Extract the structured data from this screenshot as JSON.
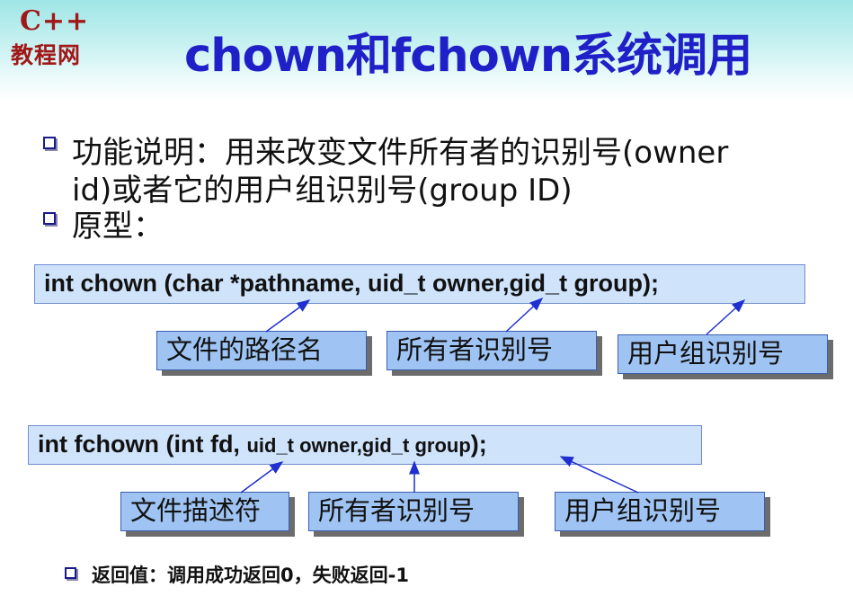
{
  "logo": {
    "line1": "C++",
    "line2": "教程网"
  },
  "title": "chown和fchown系统调用",
  "bullets": {
    "b1_line1": "功能说明：用来改变文件所有者的识别号(owner",
    "b1_line2": "id)或者它的用户组识别号(group ID)",
    "b2": "原型："
  },
  "chown": {
    "prototype": "int  chown (char *pathname, uid_t owner,gid_t group);",
    "labels": [
      "文件的路径名",
      "所有者识别号",
      "用户组识别号"
    ]
  },
  "fchown": {
    "prototype_main": "int  fchown (int  fd, ",
    "prototype_small": "uid_t owner,gid_t group",
    "prototype_end": ");",
    "labels": [
      "文件描述符",
      "所有者识别号",
      "用户组识别号"
    ]
  },
  "footer": "返回值：调用成功返回0，失败返回-1",
  "colors": {
    "title": "#2020c8",
    "logo": "#a01818",
    "code_bg": "#cfe3fb",
    "label_bg": "#9fc4f3",
    "arrow": "#1f2fd0"
  }
}
